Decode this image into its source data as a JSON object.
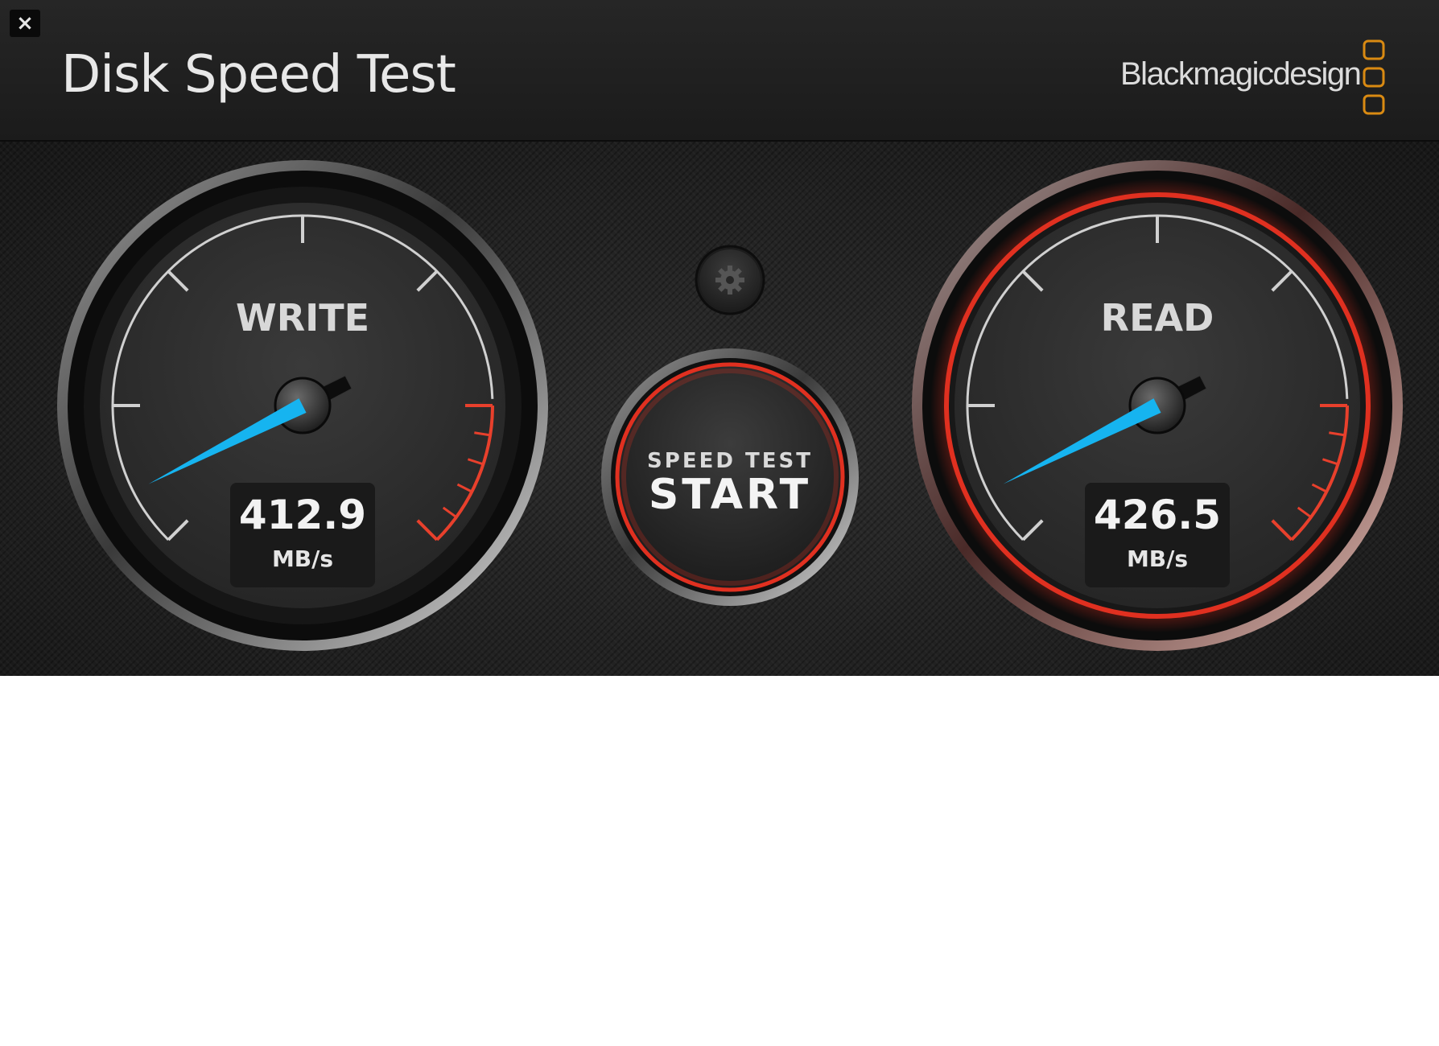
{
  "window": {
    "close_label": "×",
    "title": "Disk Speed Test",
    "brand": "Blackmagicdesign",
    "brand_color": "#d98a12"
  },
  "gauges": {
    "write": {
      "label": "WRITE",
      "value": "412.9",
      "unit": "MB/s",
      "ring_color": "#bfbfbf"
    },
    "read": {
      "label": "READ",
      "value": "426.5",
      "unit": "MB/s",
      "ring_color": "#e03020"
    }
  },
  "start_button": {
    "top_label": "SPEED TEST",
    "main_label": "START"
  },
  "settings": {
    "icon": "gear-icon"
  },
  "colors": {
    "needle": "#16b4f0",
    "redline": "#e8402c",
    "ticks": "#d0d0d0"
  }
}
